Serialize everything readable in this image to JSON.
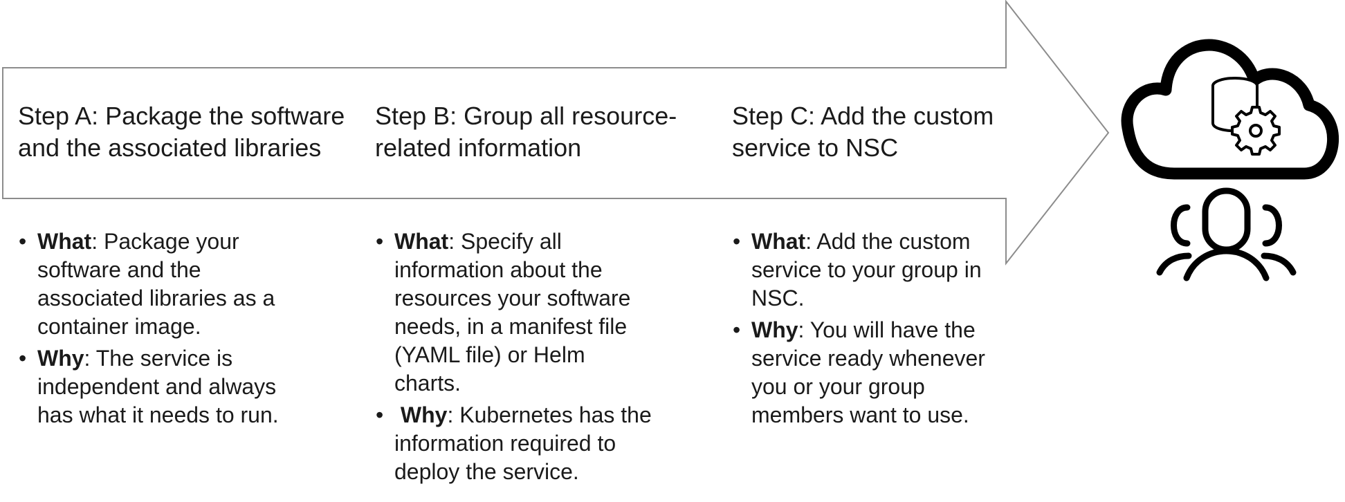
{
  "steps": [
    {
      "title_lines": [
        "Step A: Package the software",
        "and the associated libraries"
      ],
      "bullets": [
        {
          "label": "What",
          "lines": [
            ": Package your",
            "software and the",
            "associated libraries as a",
            "container image."
          ]
        },
        {
          "label": "Why",
          "lines": [
            ": The service is",
            "independent and always",
            "has what it needs to run."
          ]
        }
      ]
    },
    {
      "title_lines": [
        "Step B: Group all resource-",
        "related information"
      ],
      "bullets": [
        {
          "label": "What",
          "lines": [
            ": Specify all",
            "information about the",
            "resources your software",
            "needs, in a manifest file",
            "(YAML file) or Helm",
            "charts."
          ]
        },
        {
          "label": " Why",
          "lines": [
            ": Kubernetes has the",
            "information required to",
            "deploy the service."
          ]
        }
      ]
    },
    {
      "title_lines": [
        "Step C: Add the custom",
        "service to NSC"
      ],
      "bullets": [
        {
          "label": "What",
          "lines": [
            ": Add the custom",
            "service to your group in",
            "NSC."
          ]
        },
        {
          "label": "Why",
          "lines": [
            ": You will have the",
            "service ready whenever",
            "you or your group",
            "members want to use."
          ]
        }
      ]
    }
  ],
  "bullet_glyph": "•",
  "icons": [
    "cloud-database-settings-icon",
    "user-group-icon"
  ],
  "colors": {
    "arrow_stroke": "#8c8c8c",
    "icon": "#000000",
    "text": "#1a1a1a"
  }
}
